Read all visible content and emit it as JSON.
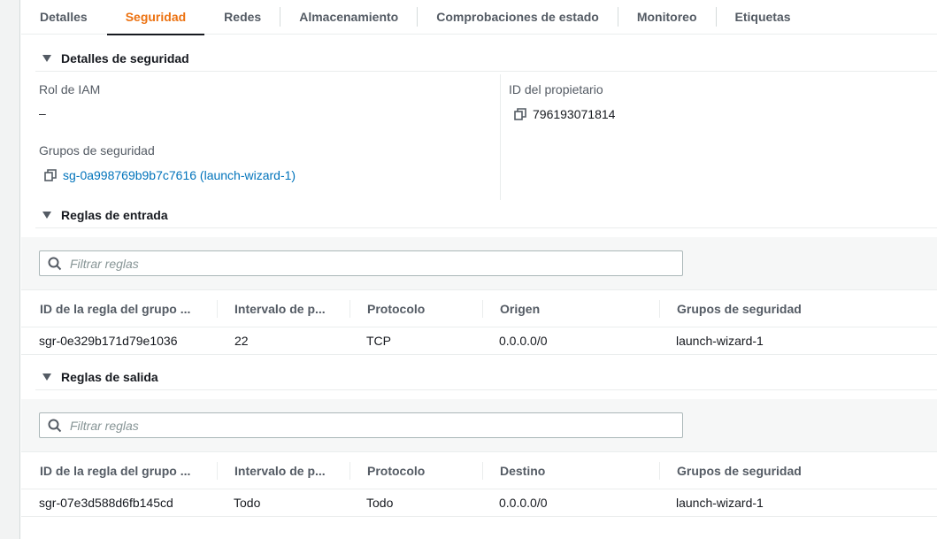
{
  "tabs": [
    {
      "label": "Detalles",
      "active": false
    },
    {
      "label": "Seguridad",
      "active": true
    },
    {
      "label": "Redes",
      "active": false
    },
    {
      "label": "Almacenamiento",
      "active": false
    },
    {
      "label": "Comprobaciones de estado",
      "active": false
    },
    {
      "label": "Monitoreo",
      "active": false
    },
    {
      "label": "Etiquetas",
      "active": false
    }
  ],
  "security_details": {
    "title": "Detalles de seguridad",
    "iam_role_label": "Rol de IAM",
    "iam_role_value": "–",
    "owner_id_label": "ID del propietario",
    "owner_id_value": "796193071814",
    "security_groups_label": "Grupos de seguridad",
    "security_group_link": "sg-0a998769b9b7c7616 (launch-wizard-1)"
  },
  "inbound": {
    "title": "Reglas de entrada",
    "filter_placeholder": "Filtrar reglas",
    "columns": [
      "ID de la regla del grupo ...",
      "Intervalo de p...",
      "Protocolo",
      "Origen",
      "Grupos de seguridad"
    ],
    "rows": [
      [
        "sgr-0e329b171d79e1036",
        "22",
        "TCP",
        "0.0.0.0/0",
        "launch-wizard-1"
      ]
    ]
  },
  "outbound": {
    "title": "Reglas de salida",
    "filter_placeholder": "Filtrar reglas",
    "columns": [
      "ID de la regla del grupo ...",
      "Intervalo de p...",
      "Protocolo",
      "Destino",
      "Grupos de seguridad"
    ],
    "rows": [
      [
        "sgr-07e3d588d6fb145cd",
        "Todo",
        "Todo",
        "0.0.0.0/0",
        "launch-wizard-1"
      ]
    ]
  },
  "icons": {
    "copy": "copy-icon",
    "search": "search-icon",
    "caret": "caret-down-icon"
  },
  "colors": {
    "accent": "#ec7211",
    "link": "#0073bb",
    "text": "#16191f",
    "muted": "#545b64"
  }
}
